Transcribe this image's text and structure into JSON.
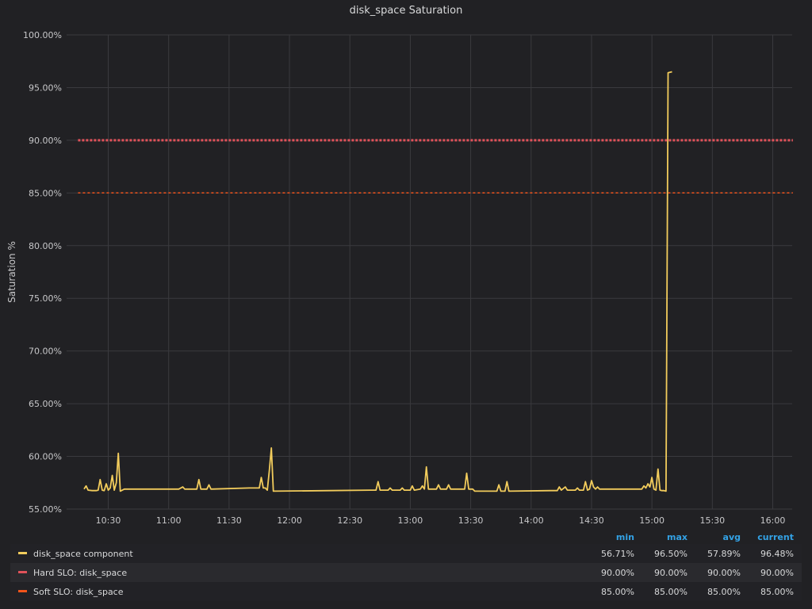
{
  "panel": {
    "title": "disk_space Saturation"
  },
  "legend": {
    "headers": [
      "min",
      "max",
      "avg",
      "current"
    ],
    "rows": [
      {
        "name": "disk_space component",
        "color": "#f2cc5c",
        "min": "56.71%",
        "max": "96.50%",
        "avg": "57.89%",
        "current": "96.48%"
      },
      {
        "name": "Hard SLO: disk_space",
        "color": "#e0525a",
        "min": "90.00%",
        "max": "90.00%",
        "avg": "90.00%",
        "current": "90.00%"
      },
      {
        "name": "Soft SLO: disk_space",
        "color": "#f2541b",
        "min": "85.00%",
        "max": "85.00%",
        "avg": "85.00%",
        "current": "85.00%"
      }
    ]
  },
  "chart_data": {
    "type": "line",
    "title": "disk_space Saturation",
    "ylabel": "Saturation %",
    "xlabel": "",
    "ylim": [
      55,
      100
    ],
    "xlim": [
      "10:15",
      "16:10"
    ],
    "y_ticks": [
      "55.00%",
      "60.00%",
      "65.00%",
      "70.00%",
      "75.00%",
      "80.00%",
      "85.00%",
      "90.00%",
      "95.00%",
      "100.00%"
    ],
    "x_ticks": [
      "10:30",
      "11:00",
      "11:30",
      "12:00",
      "12:30",
      "13:00",
      "13:30",
      "14:00",
      "14:30",
      "15:00",
      "15:30",
      "16:00"
    ],
    "grid": true,
    "legend_placement": "bottom",
    "series": [
      {
        "name": "disk_space component",
        "color": "#f2cc5c",
        "style": "solid",
        "points": [
          [
            "10:18",
            56.9
          ],
          [
            "10:19",
            57.2
          ],
          [
            "10:20",
            56.8
          ],
          [
            "10:22",
            56.75
          ],
          [
            "10:24",
            56.75
          ],
          [
            "10:25",
            56.8
          ],
          [
            "10:26",
            57.8
          ],
          [
            "10:27",
            56.8
          ],
          [
            "10:28",
            56.75
          ],
          [
            "10:29",
            57.4
          ],
          [
            "10:30",
            56.8
          ],
          [
            "10:31",
            57.0
          ],
          [
            "10:32",
            58.2
          ],
          [
            "10:33",
            56.8
          ],
          [
            "10:34",
            57.5
          ],
          [
            "10:35",
            60.3
          ],
          [
            "10:36",
            56.7
          ],
          [
            "10:37",
            56.8
          ],
          [
            "10:38",
            56.9
          ],
          [
            "10:45",
            56.9
          ],
          [
            "10:55",
            56.9
          ],
          [
            "11:00",
            56.9
          ],
          [
            "11:05",
            56.9
          ],
          [
            "11:07",
            57.1
          ],
          [
            "11:08",
            56.9
          ],
          [
            "11:14",
            56.9
          ],
          [
            "11:15",
            57.8
          ],
          [
            "11:16",
            56.9
          ],
          [
            "11:19",
            56.9
          ],
          [
            "11:20",
            57.3
          ],
          [
            "11:21",
            56.9
          ],
          [
            "11:40",
            57.0
          ],
          [
            "11:45",
            57.0
          ],
          [
            "11:46",
            58.0
          ],
          [
            "11:47",
            57.0
          ],
          [
            "11:48",
            57.0
          ],
          [
            "11:49",
            56.8
          ],
          [
            "11:50",
            58.7
          ],
          [
            "11:51",
            60.8
          ],
          [
            "11:52",
            56.7
          ],
          [
            "12:20",
            56.75
          ],
          [
            "12:40",
            56.8
          ],
          [
            "12:43",
            56.8
          ],
          [
            "12:44",
            57.6
          ],
          [
            "12:45",
            56.8
          ],
          [
            "12:49",
            56.8
          ],
          [
            "12:50",
            57.0
          ],
          [
            "12:51",
            56.8
          ],
          [
            "12:55",
            56.8
          ],
          [
            "12:56",
            57.0
          ],
          [
            "12:57",
            56.8
          ],
          [
            "13:00",
            56.8
          ],
          [
            "13:01",
            57.2
          ],
          [
            "13:02",
            56.8
          ],
          [
            "13:05",
            56.9
          ],
          [
            "13:06",
            57.2
          ],
          [
            "13:07",
            56.9
          ],
          [
            "13:08",
            59.0
          ],
          [
            "13:09",
            56.9
          ],
          [
            "13:13",
            56.9
          ],
          [
            "13:14",
            57.3
          ],
          [
            "13:15",
            56.9
          ],
          [
            "13:18",
            56.9
          ],
          [
            "13:19",
            57.3
          ],
          [
            "13:20",
            56.9
          ],
          [
            "13:27",
            56.9
          ],
          [
            "13:28",
            58.4
          ],
          [
            "13:29",
            56.9
          ],
          [
            "13:31",
            56.9
          ],
          [
            "13:32",
            56.7
          ],
          [
            "13:43",
            56.7
          ],
          [
            "13:44",
            57.3
          ],
          [
            "13:45",
            56.7
          ],
          [
            "13:47",
            56.7
          ],
          [
            "13:48",
            57.6
          ],
          [
            "13:49",
            56.7
          ],
          [
            "14:10",
            56.75
          ],
          [
            "14:13",
            56.75
          ],
          [
            "14:14",
            57.1
          ],
          [
            "14:15",
            56.8
          ],
          [
            "14:17",
            57.1
          ],
          [
            "14:18",
            56.8
          ],
          [
            "14:22",
            56.8
          ],
          [
            "14:23",
            57.0
          ],
          [
            "14:24",
            56.8
          ],
          [
            "14:26",
            56.8
          ],
          [
            "14:27",
            57.6
          ],
          [
            "14:28",
            56.8
          ],
          [
            "14:29",
            56.9
          ],
          [
            "14:30",
            57.7
          ],
          [
            "14:31",
            57.1
          ],
          [
            "14:32",
            56.9
          ],
          [
            "14:33",
            57.1
          ],
          [
            "14:34",
            56.9
          ],
          [
            "14:50",
            56.9
          ],
          [
            "14:55",
            56.9
          ],
          [
            "14:56",
            57.2
          ],
          [
            "14:57",
            57.0
          ],
          [
            "14:58",
            57.4
          ],
          [
            "14:59",
            57.1
          ],
          [
            "15:00",
            58.0
          ],
          [
            "15:01",
            56.9
          ],
          [
            "15:02",
            56.8
          ],
          [
            "15:03",
            58.8
          ],
          [
            "15:04",
            56.8
          ],
          [
            "15:05",
            56.75
          ],
          [
            "15:06",
            56.75
          ],
          [
            "15:07",
            56.7
          ],
          [
            "15:08",
            96.4
          ],
          [
            "15:10",
            96.5
          ]
        ]
      },
      {
        "name": "Hard SLO: disk_space",
        "color": "#e0525a",
        "style": "dotted",
        "points": [
          [
            "10:15",
            90
          ],
          [
            "16:10",
            90
          ]
        ]
      },
      {
        "name": "Soft SLO: disk_space",
        "color": "#f2541b",
        "style": "dashed",
        "points": [
          [
            "10:15",
            85
          ],
          [
            "16:10",
            85
          ]
        ]
      }
    ]
  }
}
